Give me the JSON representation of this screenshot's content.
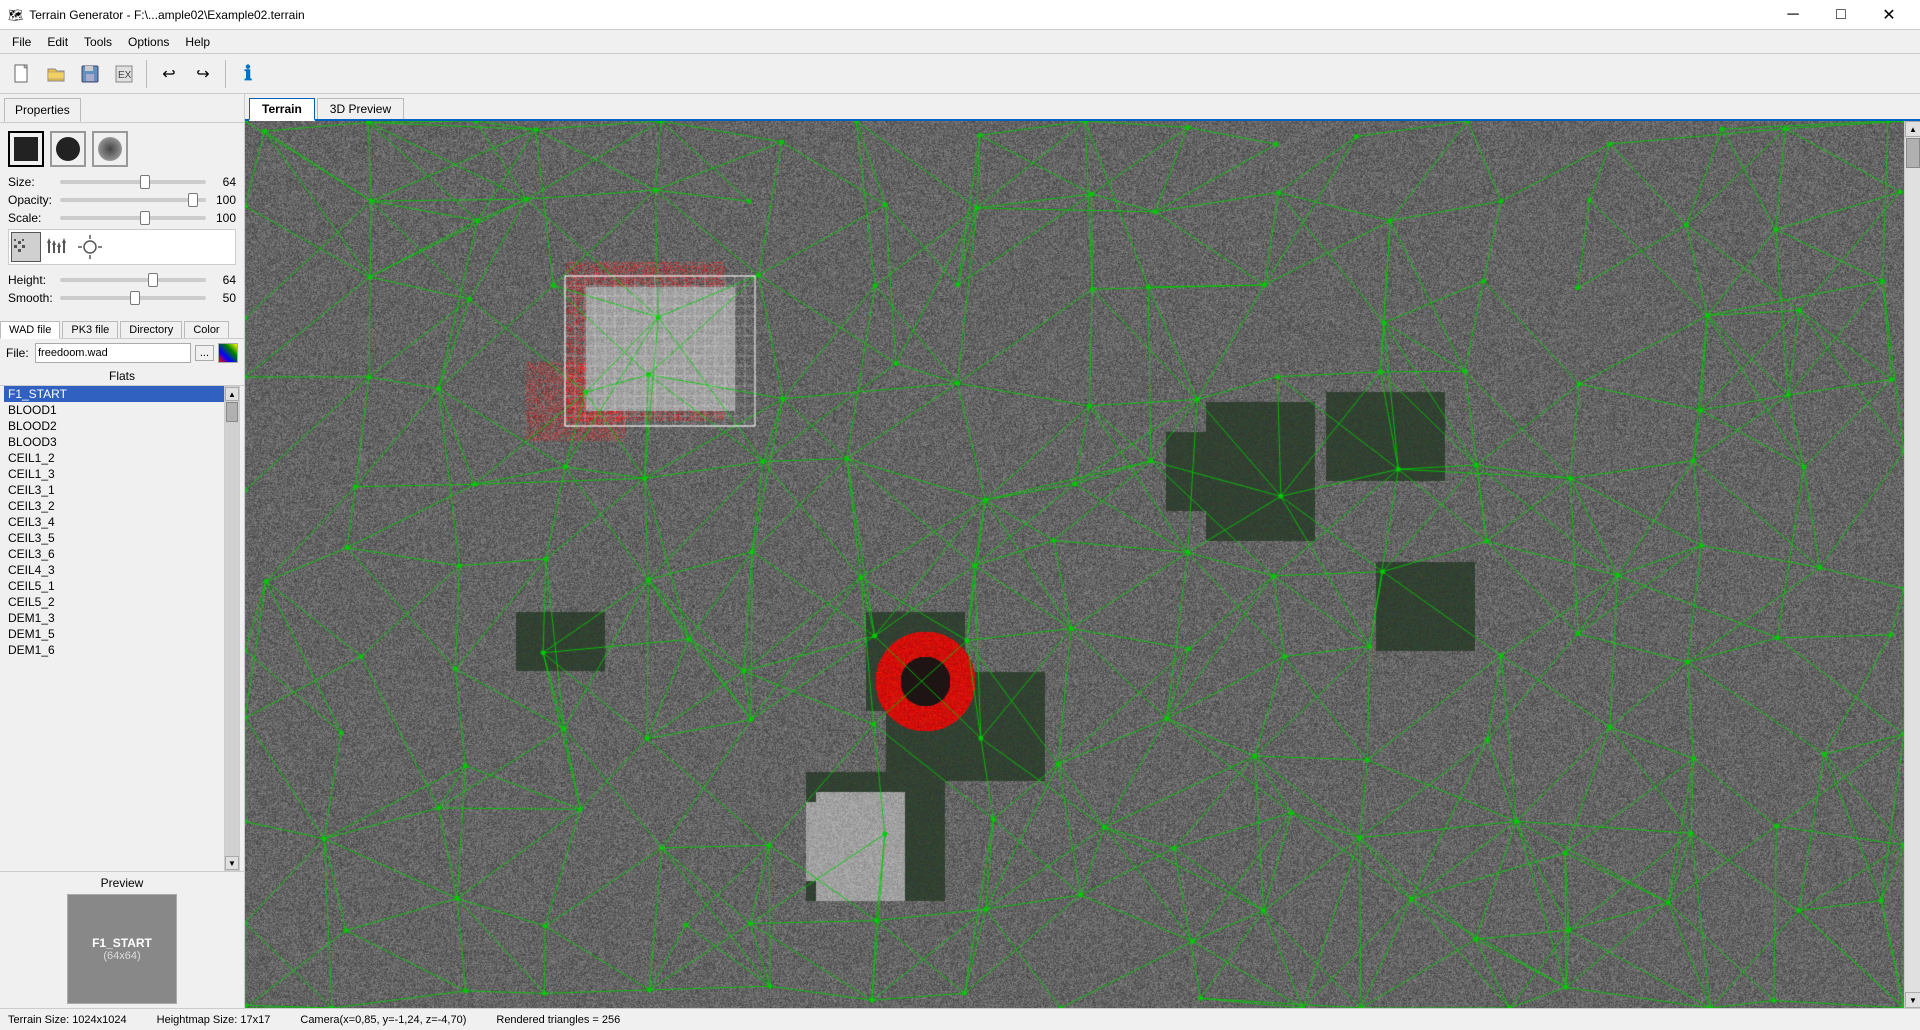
{
  "titlebar": {
    "icon": "🗺",
    "title": "Terrain Generator - F:\\...ample02\\Example02.terrain",
    "minimize_label": "─",
    "maximize_label": "□",
    "close_label": "✕"
  },
  "menubar": {
    "items": [
      "File",
      "Edit",
      "Tools",
      "Options",
      "Help"
    ]
  },
  "toolbar": {
    "buttons": [
      {
        "name": "new",
        "icon": "📄"
      },
      {
        "name": "open",
        "icon": "📂"
      },
      {
        "name": "save",
        "icon": "💾"
      },
      {
        "name": "export",
        "icon": "📋"
      },
      {
        "name": "undo",
        "icon": "↩"
      },
      {
        "name": "redo",
        "icon": "↪"
      },
      {
        "name": "info",
        "icon": "ℹ"
      }
    ]
  },
  "properties": {
    "tab_label": "Properties",
    "brushes": [
      {
        "name": "square",
        "type": "square"
      },
      {
        "name": "circle",
        "type": "circle"
      },
      {
        "name": "soft",
        "type": "soft"
      }
    ],
    "sliders": {
      "size": {
        "label": "Size:",
        "value": 64,
        "percent": 60
      },
      "opacity": {
        "label": "Opacity:",
        "value": 100,
        "percent": 90
      },
      "scale": {
        "label": "Scale:",
        "value": 100,
        "percent": 60
      }
    },
    "height_slider": {
      "label": "Height:",
      "value": 64,
      "percent": 65
    },
    "smooth_slider": {
      "label": "Smooth:",
      "value": 50,
      "percent": 50
    }
  },
  "wad_tabs": [
    "WAD file",
    "PK3 file",
    "Directory",
    "Color"
  ],
  "active_wad_tab": "WAD file",
  "file": {
    "label": "File:",
    "value": "freedoom.wad",
    "browse_label": "..."
  },
  "flats": {
    "label": "Flats",
    "items": [
      "F1_START",
      "BLOOD1",
      "BLOOD2",
      "BLOOD3",
      "CEIL1_2",
      "CEIL1_3",
      "CEIL3_1",
      "CEIL3_2",
      "CEIL3_4",
      "CEIL3_5",
      "CEIL3_6",
      "CEIL4_3",
      "CEIL5_1",
      "CEIL5_2",
      "DEM1_3",
      "DEM1_5",
      "DEM1_6"
    ],
    "selected": "F1_START"
  },
  "preview": {
    "label": "Preview",
    "texture_name": "F1_START",
    "texture_size": "(64x64)"
  },
  "view_tabs": [
    "Terrain",
    "3D Preview"
  ],
  "active_view_tab": "Terrain",
  "statusbar": {
    "terrain_size": "Terrain Size: 1024x1024",
    "heightmap_size": "Heightmap Size: 17x17",
    "camera": "Camera(x=0,85, y=-1,24, z=-4,70)",
    "triangles": "Rendered triangles = 256"
  }
}
